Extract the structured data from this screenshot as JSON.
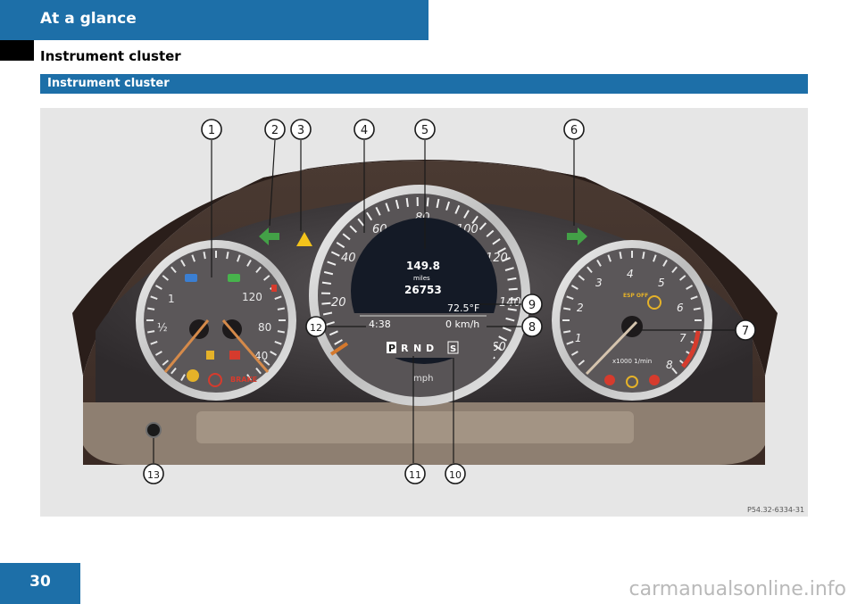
{
  "header": {
    "title": "At a glance"
  },
  "page": {
    "heading": "Instrument cluster",
    "number": "30"
  },
  "section": {
    "label": "Instrument cluster"
  },
  "figure": {
    "code": "P54.32-6334-31",
    "callouts": [
      "1",
      "2",
      "3",
      "4",
      "5",
      "6",
      "7",
      "8",
      "9",
      "10",
      "11",
      "12",
      "13"
    ],
    "display": {
      "trip": "149.8",
      "trip_unit": "miles",
      "odometer": "26753",
      "temperature": "72.5°F",
      "speed_readout": "0 km/h",
      "clock": "4:38",
      "gears": [
        "P",
        "R",
        "N",
        "D"
      ],
      "mode": "S"
    },
    "speedometer": {
      "ticks": [
        "20",
        "40",
        "60",
        "80",
        "100",
        "120",
        "140",
        "160"
      ],
      "unit": "mph"
    },
    "fuel_gauge": {
      "labels": [
        "1",
        "½"
      ]
    },
    "temp_gauge": {
      "labels": [
        "120",
        "80",
        "40"
      ],
      "brake_label": "BRAKE"
    },
    "tachometer": {
      "ticks": [
        "1",
        "2",
        "3",
        "4",
        "5",
        "6",
        "7",
        "8"
      ],
      "unit": "x1000 1/min",
      "esp_label": "ESP OFF"
    }
  },
  "watermark": "carmanualsonline.info"
}
